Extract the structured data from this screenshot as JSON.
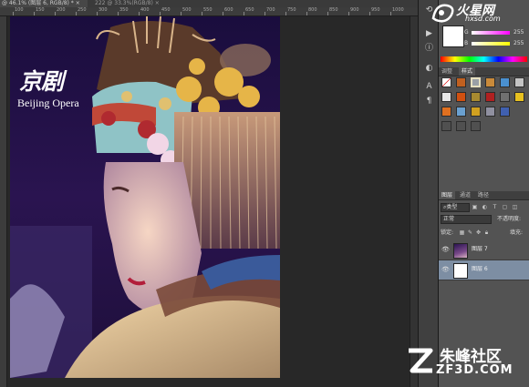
{
  "document_tabs": [
    {
      "label": "@ 46.1% (图层 6, RGB/8) *",
      "close": "×",
      "active": true
    },
    {
      "label": "222 @ 33.3%(RGB/8)",
      "close": "×",
      "active": false
    }
  ],
  "ruler_ticks": [
    "100",
    "150",
    "200",
    "250",
    "300",
    "350",
    "400",
    "450",
    "500",
    "550",
    "600",
    "650",
    "700",
    "750",
    "800",
    "850",
    "900",
    "950",
    "1000"
  ],
  "canvas": {
    "logo_cn": "京剧",
    "logo_en": "Beijing Opera"
  },
  "toolstrip": {
    "icons": [
      "history-icon",
      "actions-icon",
      "info-icon",
      "color-icon",
      "character-icon",
      "paragraph-icon"
    ]
  },
  "branding": {
    "site_name": "火星网",
    "site_url": "hxsd.com"
  },
  "color_panel": {
    "sliders": [
      {
        "letter": "G",
        "value": "255",
        "color": "#ff00ff"
      },
      {
        "letter": "B",
        "value": "255",
        "color": "#ffff00"
      }
    ]
  },
  "style_tabs": [
    {
      "label": "调整",
      "active": false
    },
    {
      "label": "样式",
      "active": true
    }
  ],
  "layers_tabs": [
    {
      "label": "图层",
      "active": true
    },
    {
      "label": "通道",
      "active": false
    },
    {
      "label": "路径",
      "active": false
    }
  ],
  "layers_panel": {
    "filter_label": "类型",
    "blend_mode": "正常",
    "opacity_label": "不透明度:",
    "lock_label": "锁定:",
    "fill_label": "填充:",
    "layers": [
      {
        "name": "图层 7",
        "selected": false,
        "thumb": "photo"
      },
      {
        "name": "图层 6",
        "selected": true,
        "thumb": "white"
      }
    ]
  },
  "watermark": {
    "text": "朱峰社区",
    "url": "ZF3D.COM"
  }
}
